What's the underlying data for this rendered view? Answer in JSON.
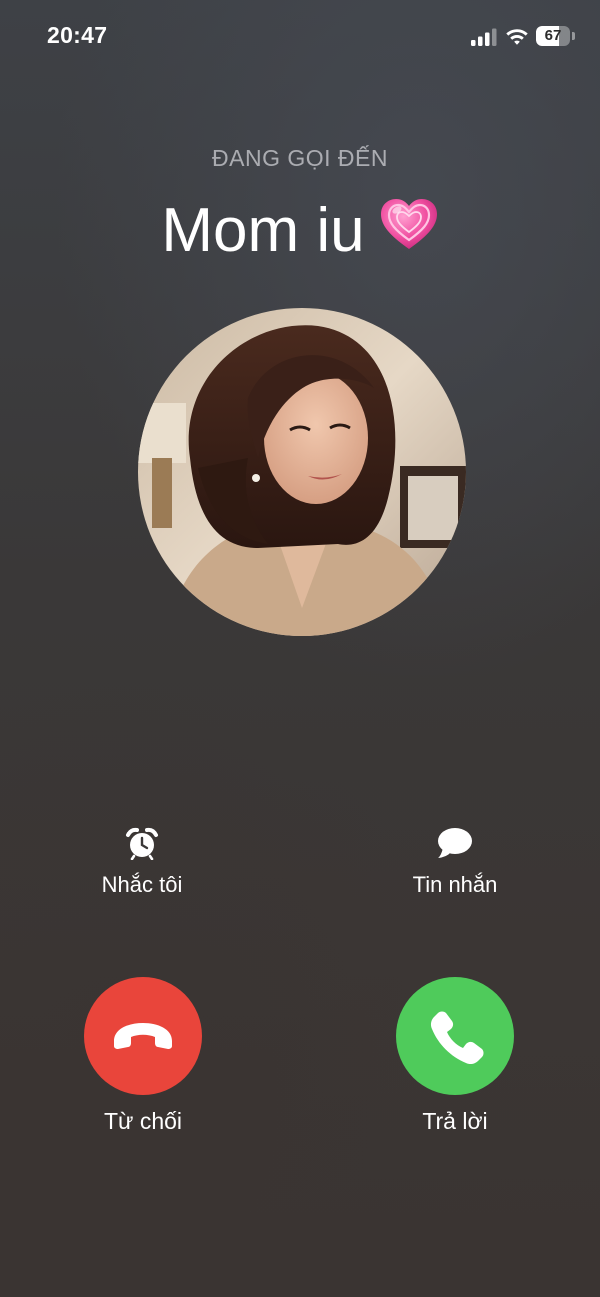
{
  "status_bar": {
    "time": "20:47",
    "signal_icon": "cellular-signal-icon",
    "wifi_icon": "wifi-icon",
    "battery_level": "67"
  },
  "call": {
    "status": "ĐANG GỌI ĐẾN",
    "caller_name": "Mom iu",
    "caller_emoji": "💗"
  },
  "actions": {
    "remind": {
      "label": "Nhắc tôi",
      "icon": "alarm-clock-icon"
    },
    "message": {
      "label": "Tin nhắn",
      "icon": "message-bubble-icon"
    }
  },
  "buttons": {
    "decline": {
      "label": "Từ chối",
      "icon": "hang-up-icon",
      "color": "#e9453b"
    },
    "accept": {
      "label": "Trả lời",
      "icon": "phone-icon",
      "color": "#4fcb5b"
    }
  }
}
